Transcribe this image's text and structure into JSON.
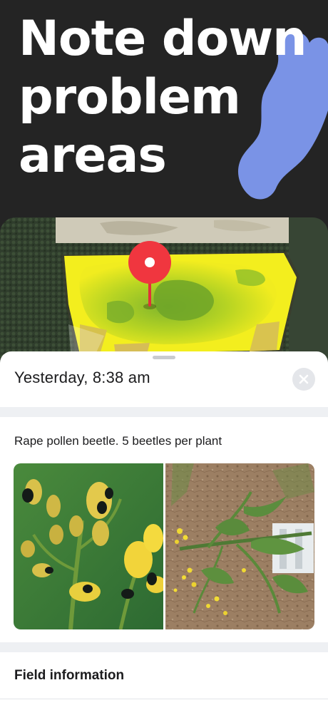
{
  "promo": {
    "headline": "Note down problem areas"
  },
  "note": {
    "timestamp": "Yesterday, 8:38 am",
    "description": "Rape pollen beetle. 5 beetles per plant",
    "close_icon": "close-icon"
  },
  "section": {
    "field_information": "Field information"
  },
  "colors": {
    "background": "#242424",
    "pin": "#f0363f",
    "accent_blob": "#7a93e6",
    "field_yellow": "#f3ee1e",
    "field_green": "#8cc02a",
    "sheet_gap": "#eef0f3"
  }
}
